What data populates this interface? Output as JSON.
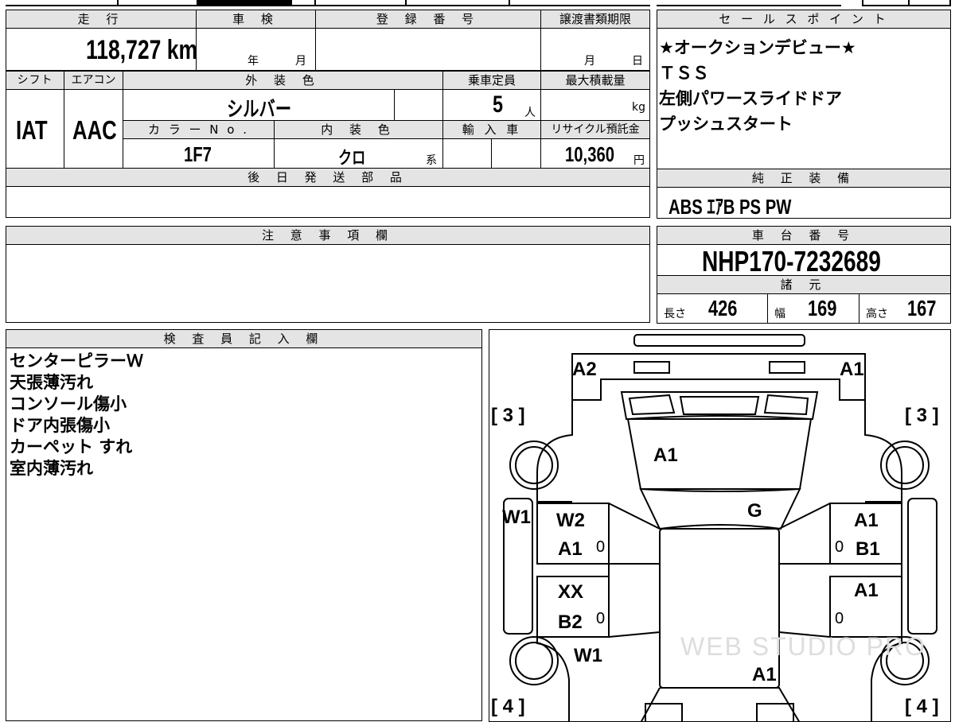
{
  "top_table": {
    "headers": {
      "mileage": "走 行",
      "inspection": "車 検",
      "registration": "登 録 番 号",
      "transfer_deadline": "譲渡書類期限",
      "shift": "シフト",
      "aircon": "エアコン",
      "exterior_color": "外 装 色",
      "capacity": "乗車定員",
      "max_load": "最大積載量",
      "color_no": "カ ラ ー N o .",
      "interior_color": "内 装 色",
      "import": "輸 入 車",
      "recycle": "リサイクル預託金",
      "later_parts": "後 日 発 送 部 品"
    },
    "values": {
      "mileage": "118,727 km",
      "inspection_year_unit": "年",
      "inspection_month_unit": "月",
      "transfer_month_unit": "月",
      "transfer_day_unit": "日",
      "shift": "IAT",
      "aircon": "AAC",
      "exterior_color": "シルバー",
      "capacity": "5",
      "capacity_unit": "人",
      "max_load_unit": "kg",
      "color_no": "1F7",
      "interior_color": "クロ",
      "interior_suffix": "系",
      "recycle": "10,360",
      "recycle_unit": "円"
    }
  },
  "sales_points": {
    "header": "セ ー ル ス ポ イ ン ト",
    "lines": [
      "★オークションデビュー★",
      "ＴＳＳ",
      "左側パワースライドドア",
      "プッシュスタート"
    ]
  },
  "genuine_equipment": {
    "header": "純 正 装 備",
    "value": "ABS ｴｱB PS PW"
  },
  "notes": {
    "header": "注 意 事 項 欄"
  },
  "chassis": {
    "header": "車 台 番 号",
    "value": "NHP170-7232689"
  },
  "specs": {
    "header": "諸 元",
    "length_label": "長さ",
    "length": "426",
    "width_label": "幅",
    "width": "169",
    "height_label": "高さ",
    "height": "167"
  },
  "inspector": {
    "header": "検 査 員 記 入 欄",
    "lines": [
      "センターピラーＷ",
      "天張薄汚れ",
      "コンソール傷小",
      "ドア内張傷小",
      "カーペット すれ",
      "室内薄汚れ"
    ]
  },
  "diagram": {
    "front_left": "A2",
    "front_right": "A1",
    "tire_fl": "[ 3 ]",
    "tire_fr": "[ 3 ]",
    "tire_rl": "[ 4 ]",
    "tire_rr": "[ 4 ]",
    "hood": "A1",
    "windshield": "G",
    "left_side": "W1",
    "left_front_door_1": "W2",
    "left_front_door_2": "A1",
    "left_rear_door_1": "XX",
    "left_rear_door_2": "B2",
    "left_rear_fender": "W1",
    "right_front_door_1": "A1",
    "right_front_door_2": "B1",
    "right_rear_door": "A1",
    "roof_rear": "A1",
    "zero": "0",
    "watermark": "WEB STUDIO PRO"
  }
}
